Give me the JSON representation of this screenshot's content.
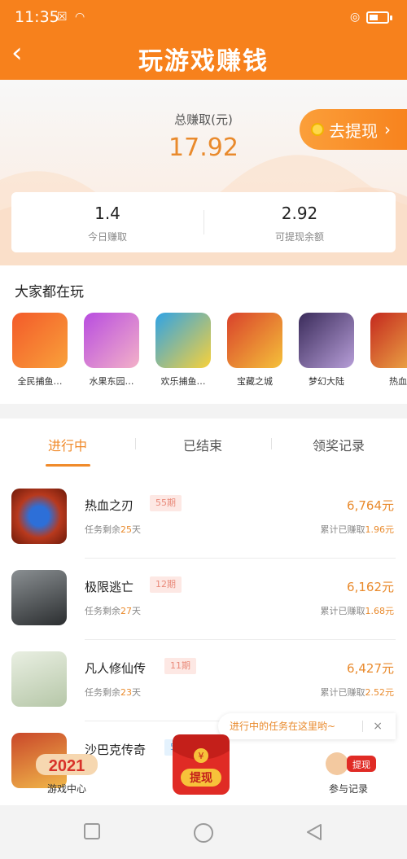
{
  "status": {
    "time": "11:35"
  },
  "header": {
    "title": "玩游戏赚钱"
  },
  "summary": {
    "total_label": "总赚取(元)",
    "total_value": "17.92",
    "withdraw_label": "去提现",
    "today_value": "1.4",
    "today_label": "今日赚取",
    "available_value": "2.92",
    "available_label": "可提现余额"
  },
  "playing": {
    "title": "大家都在玩",
    "games": [
      {
        "name": "全民捕鱼…"
      },
      {
        "name": "水果东园…"
      },
      {
        "name": "欢乐捕鱼…"
      },
      {
        "name": "宝藏之城"
      },
      {
        "name": "梦幻大陆"
      },
      {
        "name": "热血"
      }
    ]
  },
  "tabs": [
    {
      "label": "进行中"
    },
    {
      "label": "已结束"
    },
    {
      "label": "领奖记录"
    }
  ],
  "tasks": [
    {
      "name": "热血之刃",
      "tag": "55期",
      "remain_prefix": "任务剩余",
      "remain_days": "25",
      "remain_suffix": "天",
      "amount": "6,764元",
      "earned_prefix": "累计已赚取",
      "earned": "1.96元"
    },
    {
      "name": "极限逃亡",
      "tag": "12期",
      "remain_prefix": "任务剩余",
      "remain_days": "27",
      "remain_suffix": "天",
      "amount": "6,162元",
      "earned_prefix": "累计已赚取",
      "earned": "1.68元"
    },
    {
      "name": "凡人修仙传",
      "tag": "11期",
      "remain_prefix": "任务剩余",
      "remain_days": "23",
      "remain_suffix": "天",
      "amount": "6,427元",
      "earned_prefix": "累计已赚取",
      "earned": "2.52元"
    },
    {
      "name": "沙巴克传奇",
      "tag": "5期"
    }
  ],
  "tip": {
    "text": "进行中的任务在这里哟~",
    "close": "×"
  },
  "bottom_nav": {
    "left_label": "游戏中心",
    "left_badge": "2021",
    "center_label": "提现",
    "right_label": "参与记录",
    "right_badge": "提现"
  },
  "colors": {
    "brand": "#f7811c",
    "accent": "#e98a2c"
  }
}
